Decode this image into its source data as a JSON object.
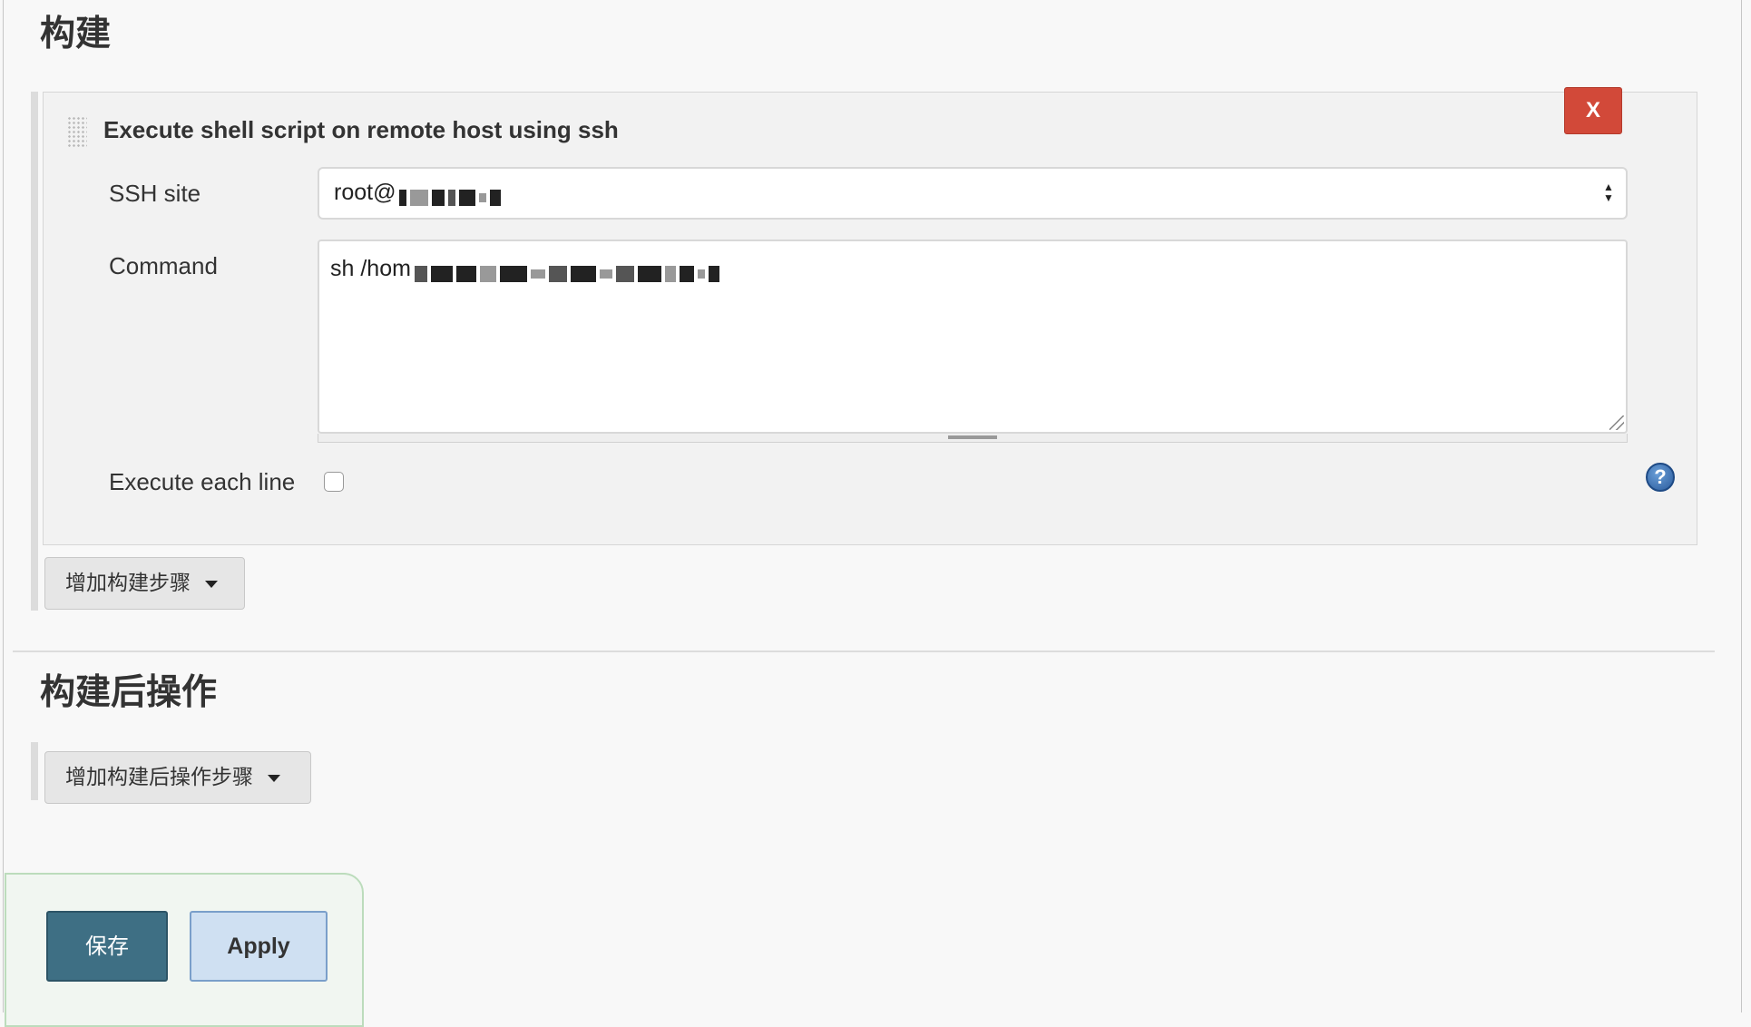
{
  "build": {
    "section_title": "构建",
    "step": {
      "title": "Execute shell script on remote host using ssh",
      "delete_label": "X",
      "ssh_site_label": "SSH site",
      "ssh_site_value": "root@",
      "command_label": "Command",
      "command_value": "sh /hom",
      "execute_each_line_label": "Execute each line",
      "execute_each_line_checked": false,
      "help_label": "?"
    },
    "add_step_label": "增加构建步骤"
  },
  "post_build": {
    "section_title": "构建后操作",
    "add_step_label": "增加构建后操作步骤"
  },
  "footer": {
    "save_label": "保存",
    "apply_label": "Apply"
  },
  "colors": {
    "delete": "#d24939",
    "save": "#3e6f84",
    "apply": "#cfe0f2",
    "help": "#2b5b9c"
  }
}
